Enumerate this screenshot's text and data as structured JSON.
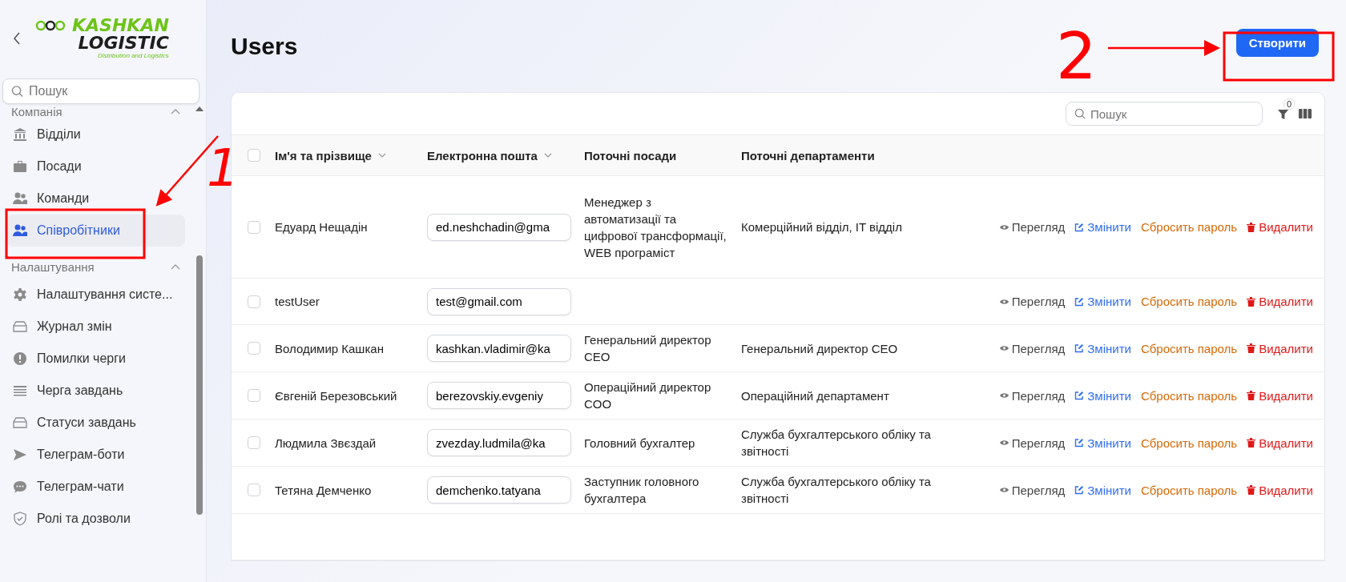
{
  "sidebar": {
    "logo": {
      "line1": "KASHKAN",
      "line2": "LOGISTIC",
      "tagline": "Distribution and Logistics"
    },
    "search": {
      "placeholder": "Пошук"
    },
    "groups": [
      {
        "title": "Компанія",
        "expanded": true,
        "items": [
          {
            "label": "Відділи",
            "kind": "bank",
            "selected": false
          },
          {
            "label": "Посади",
            "kind": "briefcase",
            "selected": false
          },
          {
            "label": "Команди",
            "kind": "team",
            "selected": false
          },
          {
            "label": "Співробітники",
            "kind": "users",
            "selected": true
          }
        ]
      },
      {
        "title": "Налаштування",
        "expanded": true,
        "items": [
          {
            "label": "Налаштування систе...",
            "kind": "gear",
            "selected": false
          },
          {
            "label": "Журнал змін",
            "kind": "tray",
            "selected": false
          },
          {
            "label": "Помилки черги",
            "kind": "alert",
            "selected": false
          },
          {
            "label": "Черга завдань",
            "kind": "lines",
            "selected": false
          },
          {
            "label": "Статуси завдань",
            "kind": "tray",
            "selected": false
          },
          {
            "label": "Телеграм-боти",
            "kind": "send",
            "selected": false
          },
          {
            "label": "Телеграм-чати",
            "kind": "chat",
            "selected": false
          },
          {
            "label": "Ролі та дозволи",
            "kind": "shield",
            "selected": false
          }
        ]
      }
    ]
  },
  "page": {
    "title": "Users",
    "create_button": "Створити"
  },
  "table": {
    "search": {
      "placeholder": "Пошук"
    },
    "filter_count": "0",
    "all_selected": false,
    "columns": [
      {
        "label": "Ім'я та прізвище",
        "sortable": true
      },
      {
        "label": "Електронна пошта",
        "sortable": true
      },
      {
        "label": "Поточні посади",
        "sortable": false
      },
      {
        "label": "Поточні департаменти",
        "sortable": false
      }
    ],
    "rows": [
      {
        "selected": false,
        "name": "Едуард Нещадін",
        "email": "ed.neshchadin@gma",
        "positions": "Менеджер з автоматизації та цифрової трансформації, WEB програміст",
        "departments": "Комерційний відділ, IT відділ",
        "actions": [
          {
            "kind": "view",
            "label": "Перегляд"
          },
          {
            "kind": "edit",
            "label": "Змінити"
          },
          {
            "kind": "reset",
            "label": "Сбросить пароль"
          },
          {
            "kind": "delete",
            "label": "Видалити"
          }
        ]
      },
      {
        "selected": false,
        "name": "testUser",
        "email": "test@gmail.com",
        "positions": "",
        "departments": "",
        "actions": [
          {
            "kind": "view",
            "label": "Перегляд"
          },
          {
            "kind": "edit",
            "label": "Змінити"
          },
          {
            "kind": "reset",
            "label": "Сбросить пароль"
          },
          {
            "kind": "delete",
            "label": "Видалити"
          }
        ]
      },
      {
        "selected": false,
        "name": "Володимир Кашкан",
        "email": "kashkan.vladimir@ka",
        "positions": "Генеральний директор CEO",
        "departments": "Генеральний директор CEO",
        "actions": [
          {
            "kind": "view",
            "label": "Перегляд"
          },
          {
            "kind": "edit",
            "label": "Змінити"
          },
          {
            "kind": "reset",
            "label": "Сбросить пароль"
          },
          {
            "kind": "delete",
            "label": "Видалити"
          }
        ]
      },
      {
        "selected": false,
        "name": "Євгеній Березовський",
        "email": "berezovskiy.evgeniy",
        "positions": "Операційний директор COO",
        "departments": "Операційний департамент",
        "actions": [
          {
            "kind": "view",
            "label": "Перегляд"
          },
          {
            "kind": "edit",
            "label": "Змінити"
          },
          {
            "kind": "reset",
            "label": "Сбросить пароль"
          },
          {
            "kind": "delete",
            "label": "Видалити"
          }
        ]
      },
      {
        "selected": false,
        "name": "Людмила Звєздай",
        "email": "zvezday.ludmila@ka",
        "positions": "Головний бухгалтер",
        "departments": "Служба бухгалтерського обліку та звітності",
        "actions": [
          {
            "kind": "view",
            "label": "Перегляд"
          },
          {
            "kind": "edit",
            "label": "Змінити"
          },
          {
            "kind": "reset",
            "label": "Сбросить пароль"
          },
          {
            "kind": "delete",
            "label": "Видалити"
          }
        ]
      },
      {
        "selected": false,
        "name": "Тетяна Демченко",
        "email": "demchenko.tatyana",
        "positions": "Заступник головного бухгалтера",
        "departments": "Служба бухгалтерського обліку та звітності",
        "actions": [
          {
            "kind": "view",
            "label": "Перегляд"
          },
          {
            "kind": "edit",
            "label": "Змінити"
          },
          {
            "kind": "reset",
            "label": "Сбросить пароль"
          },
          {
            "kind": "delete",
            "label": "Видалити"
          }
        ]
      }
    ]
  },
  "annotations": [
    {
      "label": "1"
    },
    {
      "label": "2"
    }
  ]
}
